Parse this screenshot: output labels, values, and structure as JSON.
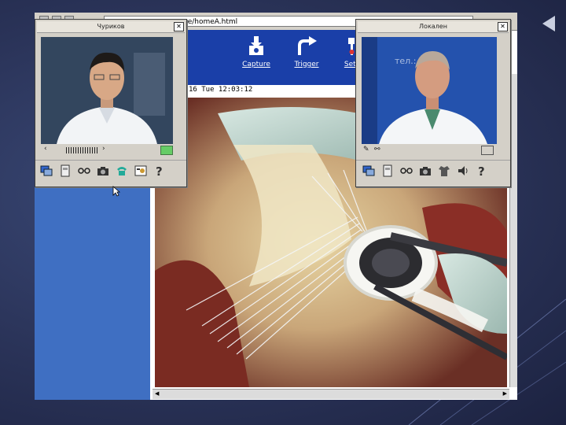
{
  "browser": {
    "address_text": "ne/homeA.html"
  },
  "web_toolbar": {
    "tools": [
      {
        "label": "Capture",
        "icon": "capture-icon"
      },
      {
        "label": "Trigger",
        "icon": "trigger-icon"
      },
      {
        "label": "Setting",
        "icon": "setting-icon"
      }
    ]
  },
  "video": {
    "timestamp": "16 Tue 12:03:12"
  },
  "remote_window": {
    "title": "Чуриков",
    "close_glyph": "✕",
    "scroll_left": "‹",
    "scroll_right": "›",
    "icons": [
      "monitor-icon",
      "cassette-icon",
      "glasses-icon",
      "camera-icon",
      "phone-icon",
      "contact-card-icon",
      "help-icon"
    ]
  },
  "local_window": {
    "title": "Локален",
    "close_glyph": "✕",
    "backdrop_text": "тел.: (",
    "icons": [
      "monitor-icon",
      "cassette-icon",
      "glasses-icon",
      "camera-icon",
      "shirt-icon",
      "speaker-icon",
      "help-icon"
    ]
  },
  "colors": {
    "browser_pane_blue": "#3f6fc2",
    "toolbar_blue": "#1a3fa8",
    "window_gray": "#d4d0c8"
  }
}
